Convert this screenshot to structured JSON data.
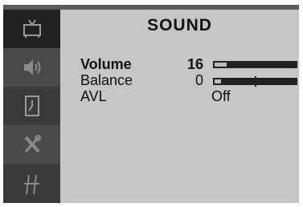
{
  "title": "SOUND",
  "sidebar": {
    "items": [
      {
        "icon": "tv-icon",
        "active": true
      },
      {
        "icon": "speaker-icon",
        "active": false
      },
      {
        "icon": "timer-icon",
        "active": false
      },
      {
        "icon": "tools-icon",
        "active": false
      },
      {
        "icon": "channel-grid-icon",
        "active": false
      }
    ]
  },
  "settings": {
    "volume": {
      "label": "Volume",
      "value": "16",
      "level": 0.16
    },
    "balance": {
      "label": "Balance",
      "value": "0",
      "level": 0.5
    },
    "avl": {
      "label": "AVL",
      "value": "Off"
    }
  },
  "colors": {
    "panel": "#c6c6c6",
    "sidebar_active": "#222222",
    "sidebar_inactive": "#4a4a4a",
    "slider_track": "#222222"
  }
}
